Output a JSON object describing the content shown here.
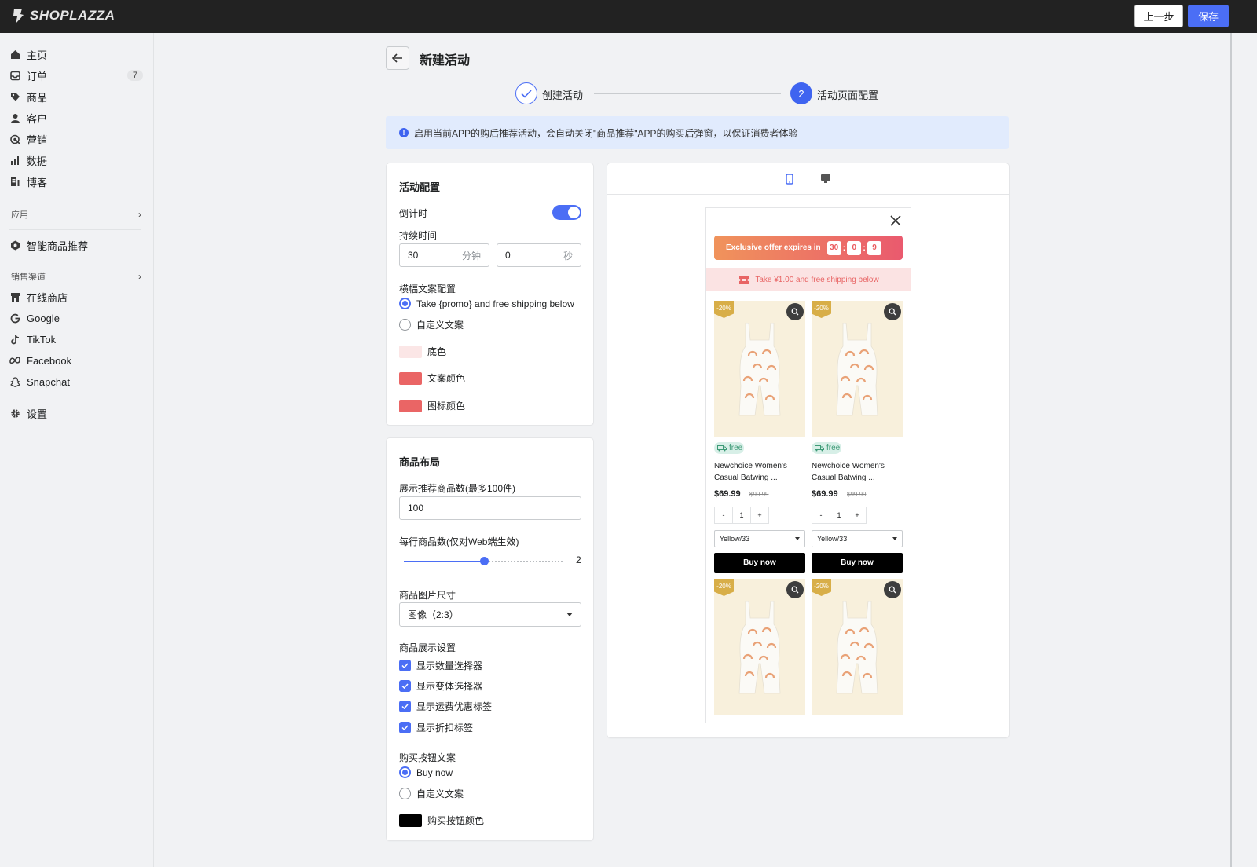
{
  "topbar": {
    "brand": "SHOPLAZZA",
    "prev_label": "上一步",
    "save_label": "保存",
    "accent": "#4b6ef5"
  },
  "sidebar": {
    "items": [
      {
        "label": "主页",
        "icon": "home-icon"
      },
      {
        "label": "订单",
        "icon": "inbox-icon",
        "badge": "7"
      },
      {
        "label": "商品",
        "icon": "tag-icon"
      },
      {
        "label": "客户",
        "icon": "person-icon"
      },
      {
        "label": "营销",
        "icon": "target-icon"
      },
      {
        "label": "数据",
        "icon": "bar-chart-icon"
      },
      {
        "label": "博客",
        "icon": "blog-icon"
      }
    ],
    "apps_section": "应用",
    "app_items": [
      {
        "label": "智能商品推荐",
        "icon": "hexagon-app-icon"
      }
    ],
    "channels_section": "销售渠道",
    "channels": [
      {
        "label": "在线商店",
        "icon": "store-icon"
      },
      {
        "label": "Google",
        "icon": "google-icon"
      },
      {
        "label": "TikTok",
        "icon": "tiktok-icon"
      },
      {
        "label": "Facebook",
        "icon": "meta-icon"
      },
      {
        "label": "Snapchat",
        "icon": "snapchat-icon"
      }
    ],
    "settings": {
      "label": "设置",
      "icon": "gear-icon"
    }
  },
  "page": {
    "title": "新建活动",
    "steps": [
      {
        "label": "创建活动",
        "state": "done"
      },
      {
        "label": "活动页面配置",
        "number": "2",
        "state": "current"
      }
    ],
    "notice": "启用当前APP的购后推荐活动，会自动关闭\"商品推荐\"APP的购买后弹窗，以保证消费者体验"
  },
  "activity_config": {
    "title": "活动配置",
    "countdown_label": "倒计时",
    "countdown_on": true,
    "duration_label": "持续时间",
    "minutes_value": "30",
    "minutes_suffix": "分钟",
    "seconds_value": "0",
    "seconds_suffix": "秒",
    "banner_label": "横幅文案配置",
    "banner_option_default": "Take {promo} and free shipping below",
    "banner_option_custom": "自定义文案",
    "bg_color_label": "底色",
    "bg_color": "#fbe6e6",
    "text_color_label": "文案颜色",
    "text_color": "#ea6565",
    "icon_color_label": "图标颜色",
    "icon_color": "#ea6565"
  },
  "layout_config": {
    "title": "商品布局",
    "count_label": "展示推荐商品数(最多100件)",
    "count_value": "100",
    "per_row_label": "每行商品数(仅对Web端生效)",
    "per_row_value": "2",
    "per_row_fraction": 0.5,
    "image_size_label": "商品图片尺寸",
    "image_size_value": "图像（2:3）",
    "display_label": "商品展示设置",
    "display_options": [
      "显示数量选择器",
      "显示变体选择器",
      "显示运费优惠标签",
      "显示折扣标签"
    ],
    "buy_label": "购买按钮文案",
    "buy_option_default": "Buy now",
    "buy_option_custom": "自定义文案",
    "buy_color_label": "购买按钮颜色",
    "buy_color": "#000000"
  },
  "preview": {
    "offer_text": "Exclusive offer expires in",
    "timer": [
      "30",
      "0",
      "9"
    ],
    "promo_text": "Take ¥1.00 and free shipping below",
    "discount_tag": "-20%",
    "free_label": "free",
    "product_name": "Newchoice Women's Casual Batwing ...",
    "price": "$69.99",
    "old_price": "$99.99",
    "qty_minus": "-",
    "qty_value": "1",
    "qty_plus": "+",
    "variant": "Yellow/33",
    "buy_label": "Buy now"
  }
}
